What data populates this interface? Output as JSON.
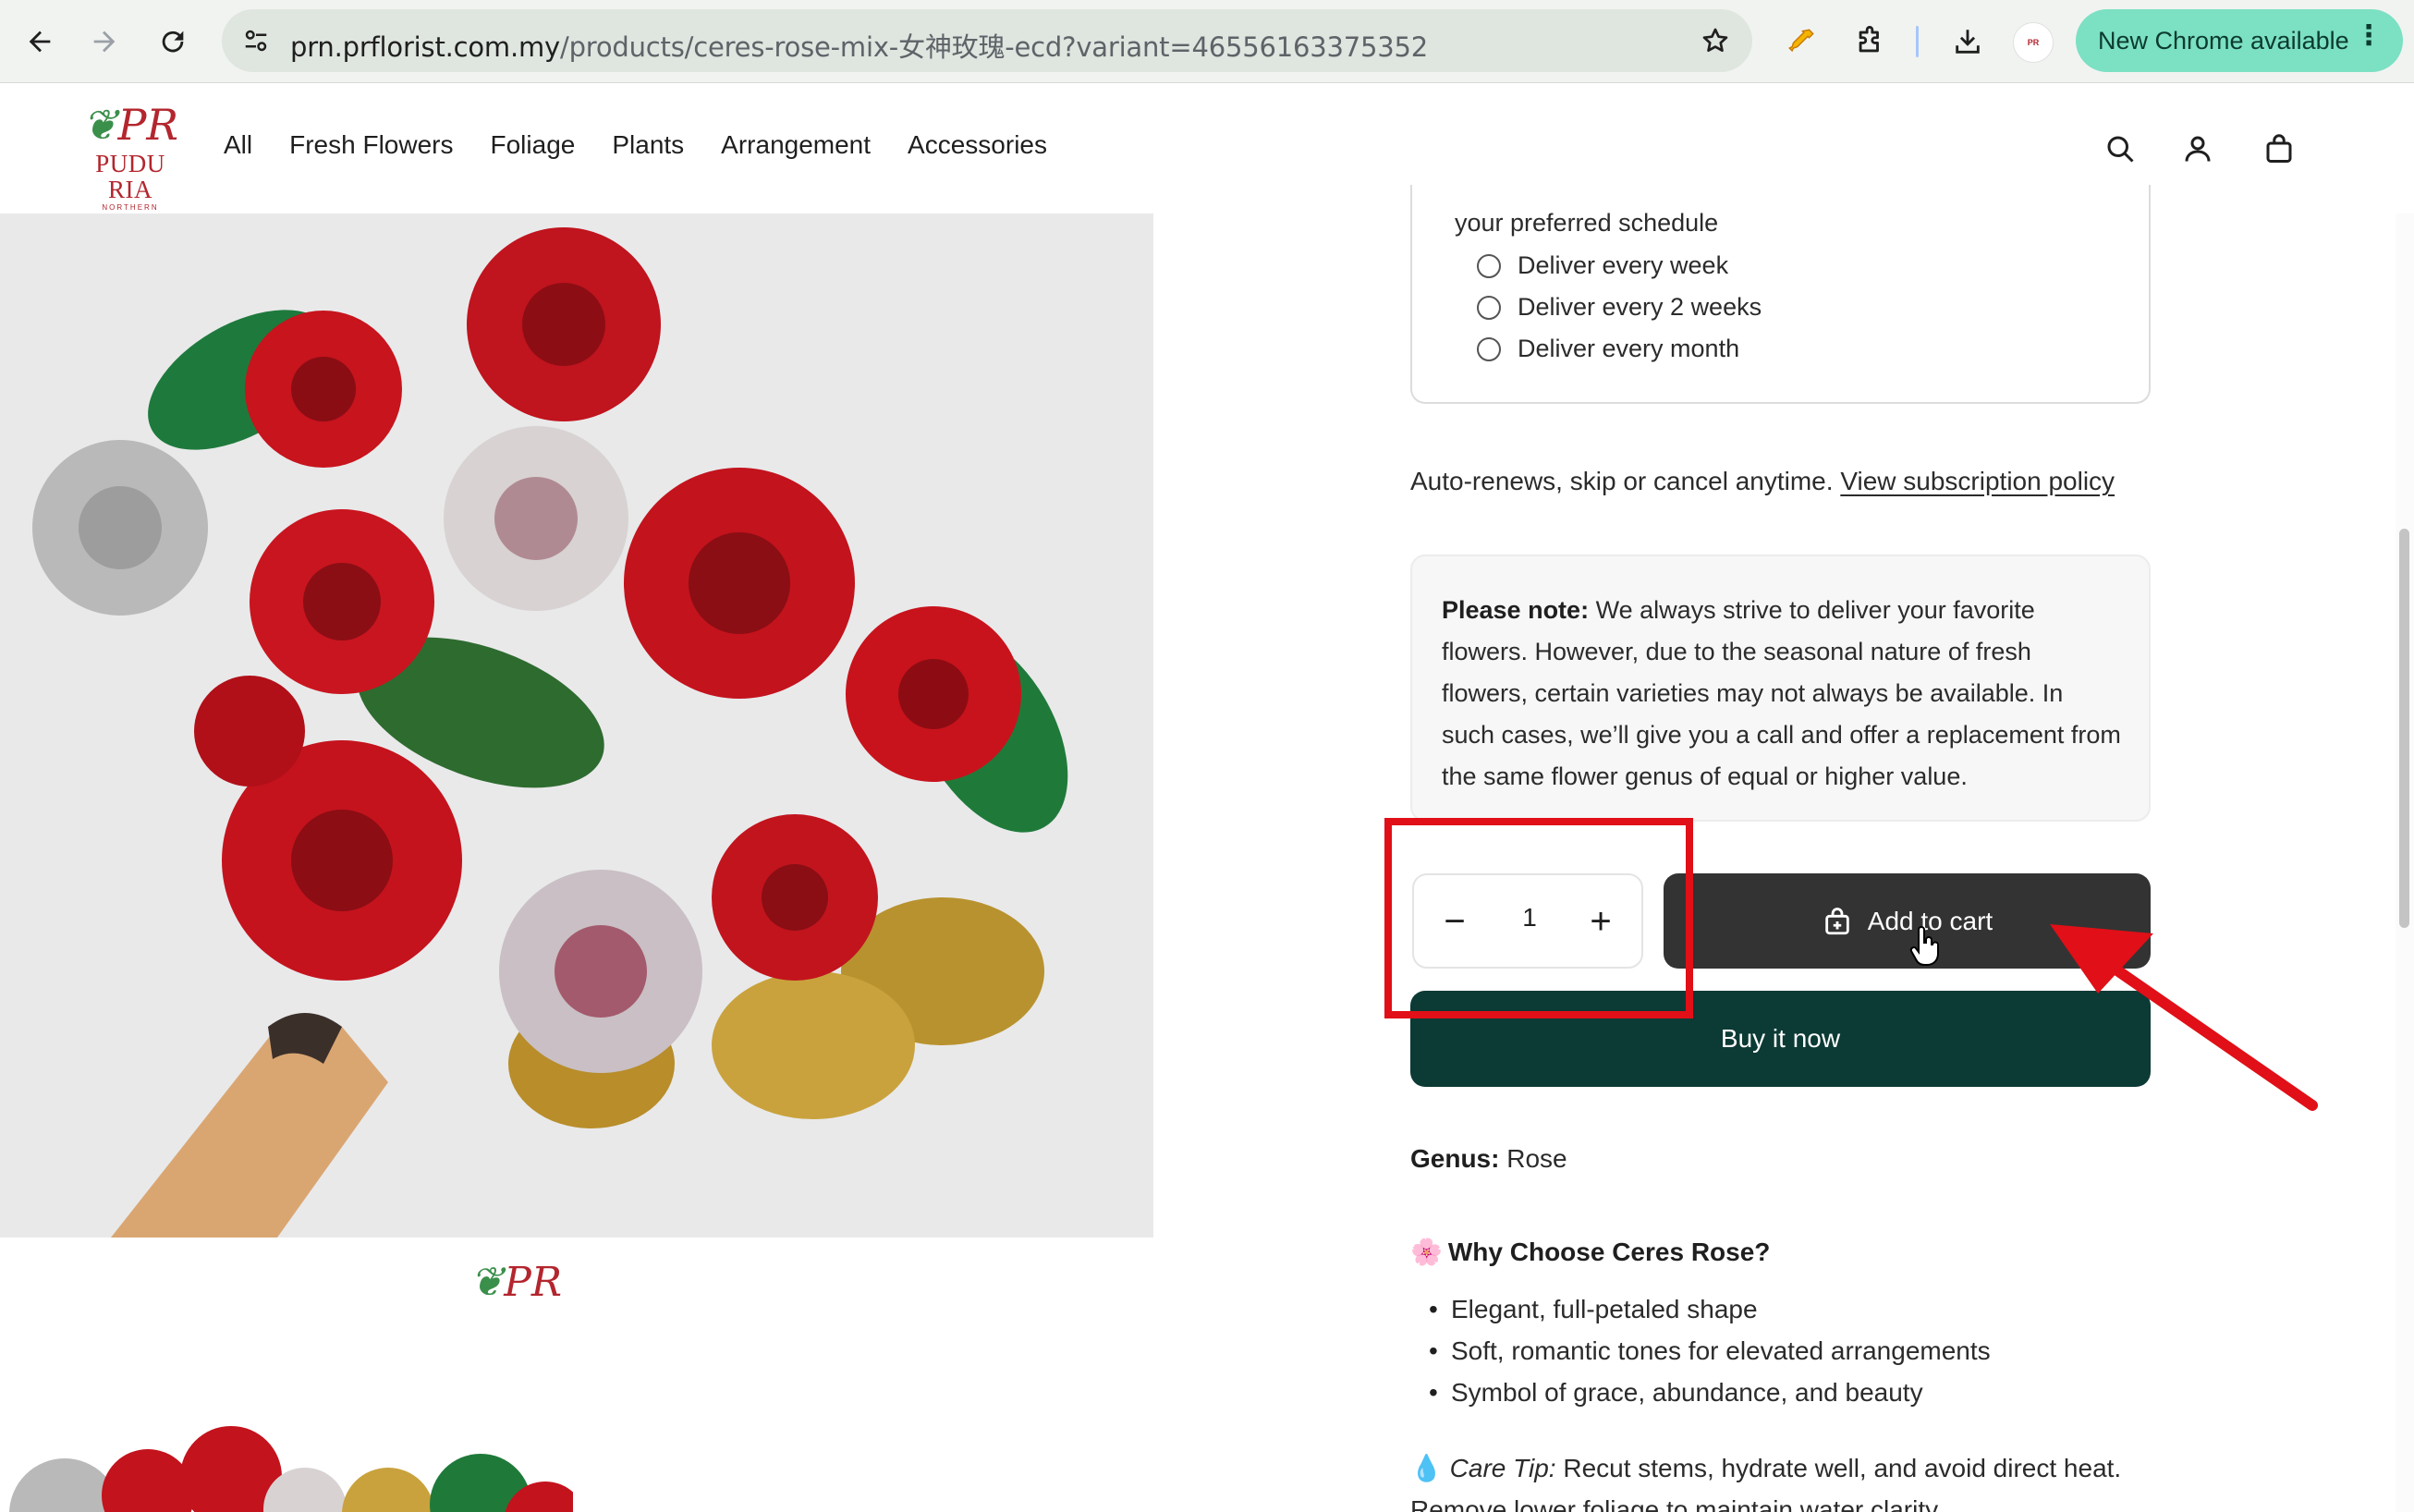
{
  "browser": {
    "url_host": "prn.prflorist.com.my",
    "url_path": "/products/ceres-rose-mix-女神玫瑰-ecd?variant=46556163375352",
    "update_button": "New Chrome available"
  },
  "site": {
    "logo_mark": "PR",
    "logo_name": "PUDU RIA",
    "logo_sub": "NORTHERN",
    "nav": [
      "All",
      "Fresh Flowers",
      "Foliage",
      "Plants",
      "Arrangement",
      "Accessories"
    ]
  },
  "subscription": {
    "lead": "your preferred schedule",
    "options": [
      "Deliver every week",
      "Deliver every 2 weeks",
      "Deliver every month"
    ],
    "autorenew_text": "Auto-renews, skip or cancel anytime.",
    "policy_link": "View subscription policy"
  },
  "note": {
    "label": "Please note:",
    "text": "We always strive to deliver your favorite flowers. However, due to the seasonal nature of fresh flowers, certain varieties may not always be available. In such cases, we’ll give you a call and offer a replacement from the same flower genus of equal or higher value."
  },
  "purchase": {
    "quantity": "1",
    "minus": "−",
    "plus": "+",
    "add_to_cart": "Add to cart",
    "buy_now": "Buy it now"
  },
  "details": {
    "genus_label": "Genus:",
    "genus_value": "Rose",
    "why_emoji": "🌸",
    "why_title": "Why Choose Ceres Rose?",
    "bullets": [
      "Elegant, full-petaled shape",
      "Soft, romantic tones for elevated arrangements",
      "Symbol of grace, abundance, and beauty"
    ],
    "care_emoji": "💧",
    "care_label": "Care Tip:",
    "care_text": "Recut stems, hydrate well, and avoid direct heat.",
    "care_text_2": "Remove lower foliage to maintain water clarity."
  },
  "colors": {
    "accent_dark": "#0c3a35",
    "add_to_cart_bg": "#333333",
    "annotation_red": "#e10f17",
    "update_pill": "#7ce0c3",
    "brand_red": "#b3262e"
  }
}
